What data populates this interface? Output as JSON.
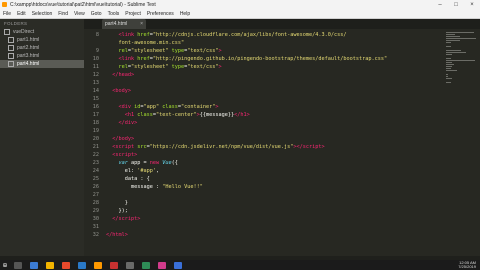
{
  "window": {
    "title": "C:\\xampp\\htdocs\\vue\\tutorial\\pat2\\html\\vue\\tutorial) - Sublime Text"
  },
  "menu": [
    "File",
    "Edit",
    "Selection",
    "Find",
    "View",
    "Goto",
    "Tools",
    "Project",
    "Preferences",
    "Help"
  ],
  "sidebar": {
    "header": "FOLDERS",
    "folder": "vueDirect",
    "files": [
      "part1.html",
      "part2.html",
      "part3.html",
      "part4.html"
    ],
    "active_index": 3
  },
  "tab": {
    "label": "part4.html",
    "close": "×"
  },
  "editor": {
    "lines": [
      {
        "n": "8",
        "html": "    <span class='t'>&lt;link</span> <span class='a'>href</span>=<span class='s'>\"http://cdnjs.cloudflare.com/ajax/libs/font-awesome/4.3.0/css/</span>"
      },
      {
        "n": "",
        "html": "    <span class='s'>font-awesome.min.css\"</span>"
      },
      {
        "n": "9",
        "html": "    <span class='a'>rel</span>=<span class='s'>\"stylesheet\"</span> <span class='a'>type</span>=<span class='s'>\"text/css\"</span><span class='t'>&gt;</span>"
      },
      {
        "n": "10",
        "html": "    <span class='t'>&lt;link</span> <span class='a'>href</span>=<span class='s'>\"http://pingendo.github.io/pingendo-bootstrap/themes/default/bootstrap.css\"</span>"
      },
      {
        "n": "11",
        "html": "    <span class='a'>rel</span>=<span class='s'>\"stylesheet\"</span> <span class='a'>type</span>=<span class='s'>\"text/css\"</span><span class='t'>&gt;</span>"
      },
      {
        "n": "12",
        "html": "  <span class='t'>&lt;/head&gt;</span>"
      },
      {
        "n": "13",
        "html": ""
      },
      {
        "n": "14",
        "html": "  <span class='t'>&lt;body&gt;</span>"
      },
      {
        "n": "15",
        "html": ""
      },
      {
        "n": "16",
        "html": "    <span class='t'>&lt;div</span> <span class='a'>id</span>=<span class='s'>\"app\"</span> <span class='a'>class</span>=<span class='s'>\"container\"</span><span class='t'>&gt;</span>"
      },
      {
        "n": "17",
        "html": "      <span class='t'>&lt;h1</span> <span class='a'>class</span>=<span class='s'>\"text-center\"</span><span class='t'>&gt;</span>{{message}}<span class='t'>&lt;/h1&gt;</span>"
      },
      {
        "n": "18",
        "html": "    <span class='t'>&lt;/div&gt;</span>"
      },
      {
        "n": "19",
        "html": ""
      },
      {
        "n": "20",
        "html": "  <span class='t'>&lt;/body&gt;</span>"
      },
      {
        "n": "21",
        "html": "  <span class='t'>&lt;script</span> <span class='a'>src</span>=<span class='s'>\"https://cdn.jsdelivr.net/npm/vue/dist/vue.js\"</span><span class='t'>&gt;&lt;/script&gt;</span>"
      },
      {
        "n": "22",
        "html": "  <span class='t'>&lt;script&gt;</span>"
      },
      {
        "n": "23",
        "html": "    <span class='k'>var</span> app = <span class='t'>new</span> <span class='k'>Vue</span>({"
      },
      {
        "n": "24",
        "html": "      el: <span class='s'>'#app'</span>,"
      },
      {
        "n": "25",
        "html": "      data : {"
      },
      {
        "n": "26",
        "html": "        message : <span class='s'>\"Hello Vue!!\"</span>"
      },
      {
        "n": "27",
        "html": ""
      },
      {
        "n": "28",
        "html": "      }"
      },
      {
        "n": "29",
        "html": "    });"
      },
      {
        "n": "30",
        "html": "  <span class='t'>&lt;/script&gt;</span>"
      },
      {
        "n": "31",
        "html": ""
      },
      {
        "n": "32",
        "html": "<span class='t'>&lt;/html&gt;</span>"
      }
    ]
  },
  "tray": {
    "time": "12:05 AM",
    "date": "7/25/2019"
  },
  "colors": {
    "editor_bg": "#272822",
    "tag": "#f92672",
    "attr": "#a6e22e",
    "string": "#e6db74"
  }
}
